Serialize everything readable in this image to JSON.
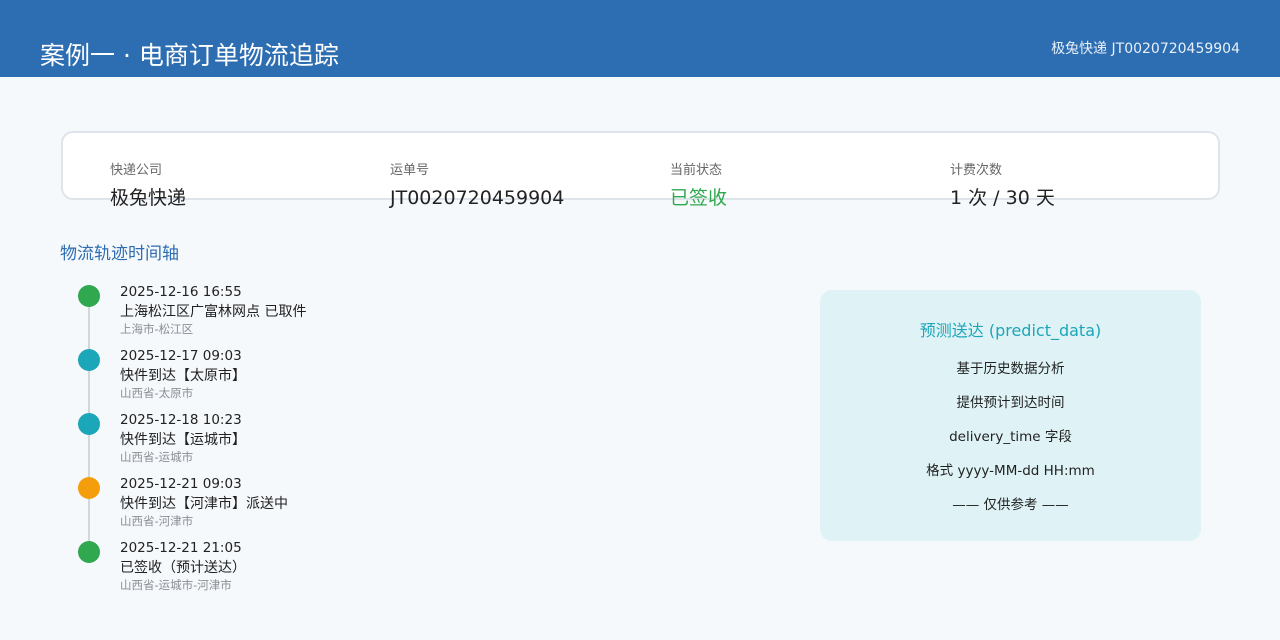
{
  "header": {
    "title": "案例一 · 电商订单物流追踪",
    "tracking_summary": "极兔快递 JT0020720459904",
    "bg_color": "#2d6db1"
  },
  "info": [
    {
      "label": "快递公司",
      "value": "极兔快递"
    },
    {
      "label": "运单号",
      "value": "JT0020720459904"
    },
    {
      "label": "当前状态",
      "value": "已签收",
      "color": "#2fa84f"
    },
    {
      "label": "计费次数",
      "value": "1 次 / 30 天"
    }
  ],
  "timeline": {
    "title": "物流轨迹时间轴",
    "events": [
      {
        "time": "2025-12-16 16:55",
        "event": "上海松江区广富林网点 已取件",
        "location": "上海市-松江区",
        "dot_color": "#2fa84f"
      },
      {
        "time": "2025-12-17 09:03",
        "event": "快件到达【太原市】",
        "location": "山西省-太原市",
        "dot_color": "#1ba6b9"
      },
      {
        "time": "2025-12-18 10:23",
        "event": "快件到达【运城市】",
        "location": "山西省-运城市",
        "dot_color": "#1ba6b9"
      },
      {
        "time": "2025-12-21 09:03",
        "event": "快件到达【河津市】派送中",
        "location": "山西省-河津市",
        "dot_color": "#f59e0b"
      },
      {
        "time": "2025-12-21 21:05",
        "event": "已签收（预计送达）",
        "location": "山西省-运城市-河津市",
        "dot_color": "#2fa84f"
      }
    ]
  },
  "predict": {
    "title": "预测送达 (predict_data)",
    "lines": [
      "基于历史数据分析",
      "提供预计到达时间",
      "delivery_time 字段",
      "格式 yyyy-MM-dd HH:mm",
      "—— 仅供参考 ——"
    ]
  }
}
